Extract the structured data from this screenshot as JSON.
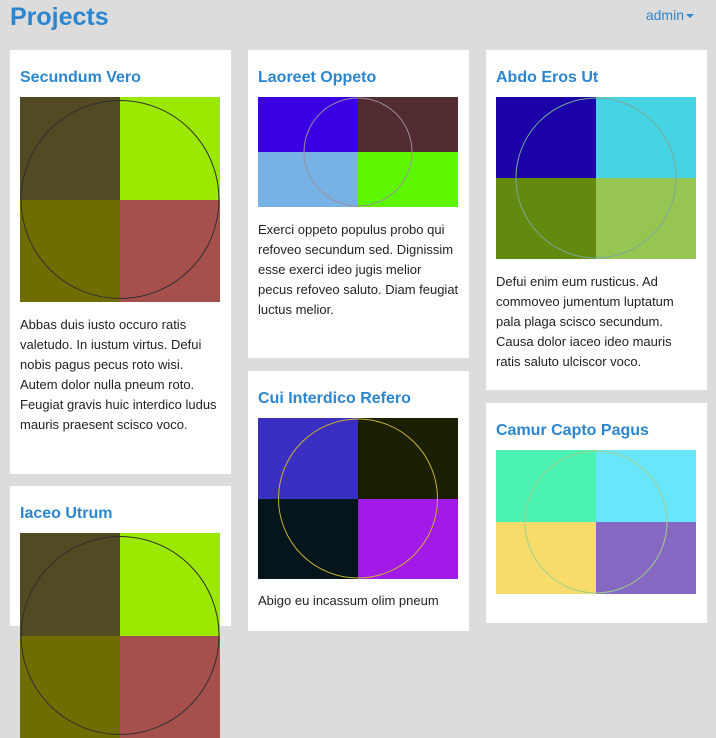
{
  "header": {
    "title": "Projects",
    "user_label": "admin"
  },
  "projects": [
    {
      "title": "Secundum Vero",
      "description": "Abbas duis iusto occuro ratis valetudo. In iustum virtus. Defui nobis pagus pecus roto wisi. Autem dolor nulla pneum roto. Feugiat gravis huic interdico ludus mauris praesent scisco voco.",
      "colors": [
        "#514a22",
        "#9be800",
        "#6f6d00",
        "#a6504e"
      ],
      "ring_color": "#2f2f2f"
    },
    {
      "title": "Laoreet Oppeto",
      "description": "Exerci oppeto populus probo qui refoveo secundum sed. Dignissim esse exerci ideo jugis melior pecus refoveo saluto. Diam feugiat luctus melior.",
      "colors": [
        "#3a00e3",
        "#522c31",
        "#78b2e4",
        "#5cf700"
      ],
      "ring_color": "#9a8fa0"
    },
    {
      "title": "Abdo Eros Ut",
      "description": "Defui enim eum rusticus. Ad commoveo jumentum luptatum pala plaga scisco secundum. Causa dolor iaceo ideo mauris ratis saluto ulciscor voco.",
      "colors": [
        "#1a02a8",
        "#46d4e4",
        "#628a0f",
        "#96c552"
      ],
      "ring_color": "#7ba89a"
    },
    {
      "title": "Iaceo Utrum",
      "description": "",
      "colors": [
        "#514a22",
        "#9be800",
        "#6f6d00",
        "#a6504e"
      ],
      "ring_color": "#2f2f2f"
    },
    {
      "title": "Cui Interdico Refero",
      "description": "Abigo eu incassum olim pneum",
      "colors": [
        "#3a2fc0",
        "#1a1f02",
        "#05151c",
        "#a21ae8"
      ],
      "ring_color": "#c8b230"
    },
    {
      "title": "Camur Capto Pagus",
      "description": "",
      "colors": [
        "#4cf2b2",
        "#6ae6fa",
        "#f7dc6c",
        "#8468c2"
      ],
      "ring_color": "#9ed08a"
    }
  ]
}
